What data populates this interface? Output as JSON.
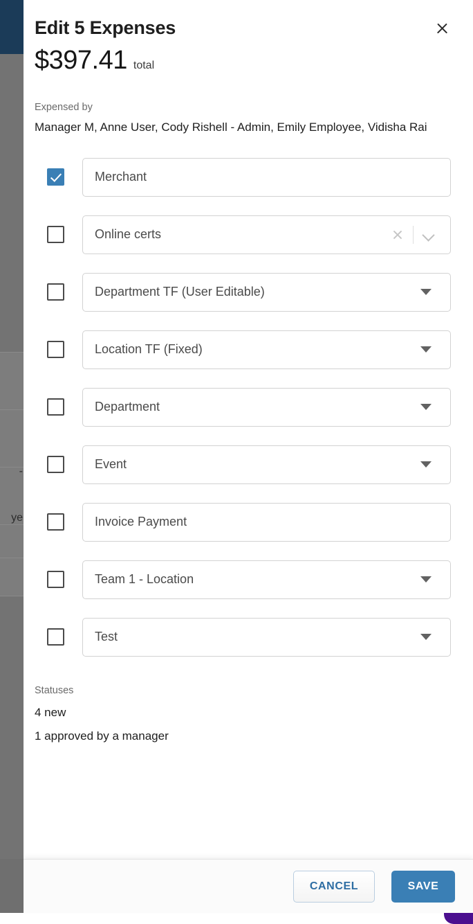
{
  "dialog": {
    "title": "Edit 5 Expenses",
    "close_label": "Close",
    "total_amount": "$397.41",
    "total_suffix": "total",
    "expensed_by_label": "Expensed by",
    "expensed_by_names": "Manager M, Anne User, Cody Rishell - Admin, Emily Employee, Vidisha Rai"
  },
  "fields": [
    {
      "label": "Merchant",
      "checked": true,
      "control": "text"
    },
    {
      "label": "Online certs",
      "checked": false,
      "control": "clearable-select"
    },
    {
      "label": "Department TF (User Editable)",
      "checked": false,
      "control": "select"
    },
    {
      "label": "Location TF (Fixed)",
      "checked": false,
      "control": "select"
    },
    {
      "label": "Department",
      "checked": false,
      "control": "select"
    },
    {
      "label": "Event",
      "checked": false,
      "control": "select"
    },
    {
      "label": "Invoice Payment",
      "checked": false,
      "control": "text"
    },
    {
      "label": "Team 1 - Location",
      "checked": false,
      "control": "select"
    },
    {
      "label": "Test",
      "checked": false,
      "control": "select"
    }
  ],
  "statuses": {
    "label": "Statuses",
    "lines": [
      "4 new",
      "1 approved by a manager"
    ]
  },
  "footer": {
    "cancel_label": "CANCEL",
    "save_label": "SAVE"
  },
  "colors": {
    "accent_blue": "#3a7fb5",
    "link_blue": "#2d6da3",
    "navy_topbar": "#1b3b58",
    "backdrop_dim": "#737373",
    "corner_accent_purple": "#4b0f8f",
    "field_border": "#d2d2d2",
    "text_primary": "#1e1e1e",
    "text_muted": "#6a6a6a"
  }
}
